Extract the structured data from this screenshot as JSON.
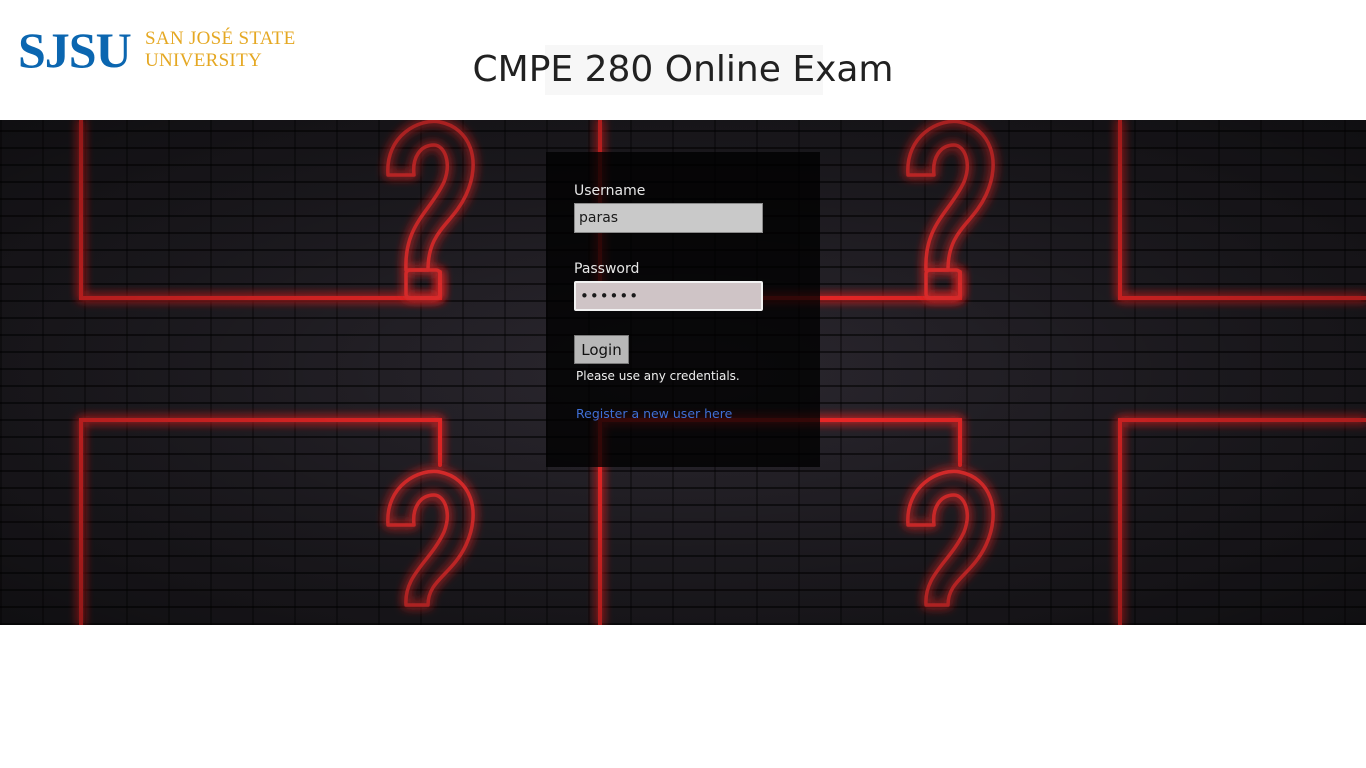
{
  "header": {
    "logo": {
      "mark": "SJSU",
      "line1": "SAN JOSÉ STATE",
      "line2": "UNIVERSITY"
    },
    "title": "CMPE 280 Online Exam"
  },
  "login": {
    "username_label": "Username",
    "username_value": "paras",
    "password_label": "Password",
    "password_value": "paras1",
    "login_button": "Login",
    "hint": "Please use any credentials.",
    "register_link": "Register a new user here"
  },
  "theme": {
    "brand_blue": "#0b66b0",
    "brand_gold": "#e5a823",
    "neon_red": "#ff2a2a",
    "link_blue": "#3f6fd6",
    "icons": [
      "question-mark-neon-icon"
    ]
  }
}
